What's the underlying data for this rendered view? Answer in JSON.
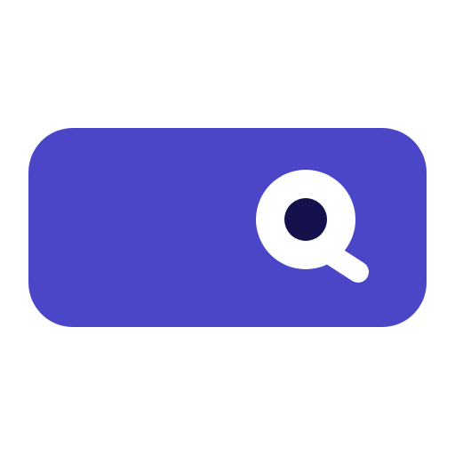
{
  "icon": {
    "name": "search-icon",
    "colors": {
      "background": "#4b45c7",
      "lens_ring": "#ffffff",
      "lens_center": "#15114d",
      "handle": "#ffffff"
    }
  }
}
